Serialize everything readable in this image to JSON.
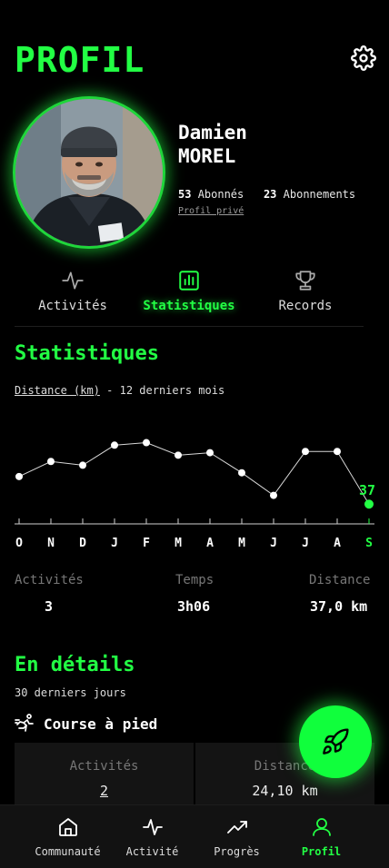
{
  "header": {
    "title": "PROFIL",
    "settings_icon": "gear-icon"
  },
  "profile": {
    "first_name": "Damien",
    "last_name": "MOREL",
    "followers_count": "53",
    "followers_label": "Abonnés",
    "following_count": "23",
    "following_label": "Abonnements",
    "privacy": "Profil privé"
  },
  "tabs": [
    {
      "label": "Activités",
      "icon": "activity-pulse-icon",
      "active": false
    },
    {
      "label": "Statistiques",
      "icon": "bar-chart-icon",
      "active": true
    },
    {
      "label": "Records",
      "icon": "trophy-icon",
      "active": false
    }
  ],
  "stats": {
    "title": "Statistiques",
    "metric": "Distance (km)",
    "period": "- 12 derniers mois"
  },
  "chart_data": {
    "type": "line",
    "x": [
      "O",
      "N",
      "D",
      "J",
      "F",
      "M",
      "A",
      "M",
      "J",
      "J",
      "A",
      "S"
    ],
    "values": [
      59,
      71,
      68,
      84,
      86,
      76,
      78,
      62,
      44,
      79,
      79,
      37
    ],
    "highlight_label": "37",
    "accent_color": "#22ff44"
  },
  "summary": [
    {
      "label": "Activités",
      "value": "3"
    },
    {
      "label": "Temps",
      "value": "3h06"
    },
    {
      "label": "Distance",
      "value": "37,0 km"
    }
  ],
  "details": {
    "title": "En détails",
    "subtitle": "30 derniers jours",
    "sport": "Course à pied",
    "sport_icon": "runner-icon",
    "cards": [
      {
        "label": "Activités",
        "value": "2"
      },
      {
        "label": "Distance",
        "value": "24,10 km"
      }
    ]
  },
  "fab": {
    "icon": "rocket-icon"
  },
  "bottom_nav": [
    {
      "label": "Communauté",
      "icon": "home-icon",
      "active": false
    },
    {
      "label": "Activité",
      "icon": "activity-pulse-icon",
      "active": false
    },
    {
      "label": "Progrès",
      "icon": "trending-up-icon",
      "active": false
    },
    {
      "label": "Profil",
      "icon": "user-icon",
      "active": true
    }
  ]
}
